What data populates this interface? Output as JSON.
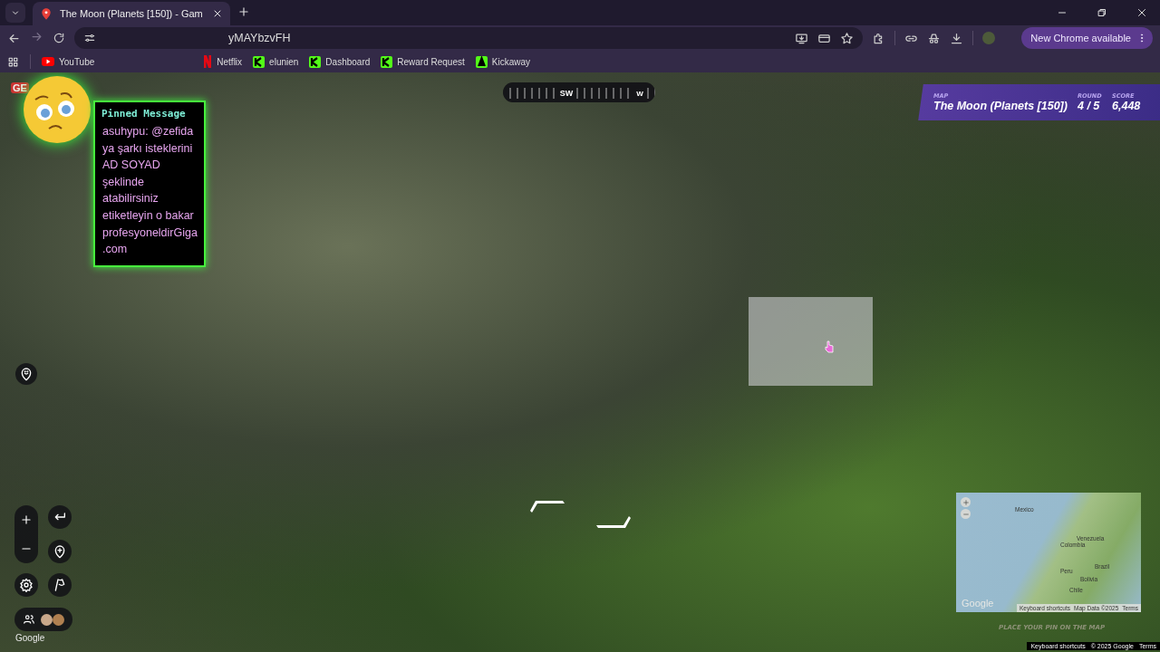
{
  "browser": {
    "tabs": [
      {
        "title": "The Moon (Planets [150]) - Gam",
        "selected": true
      }
    ],
    "address": "yMAYbzvFH",
    "update_button": "New Chrome available",
    "bookmarks": [
      {
        "label": "YouTube",
        "kind": "youtube"
      },
      {
        "label": "Netflix",
        "kind": "netflix"
      },
      {
        "label": "elunien",
        "kind": "kick"
      },
      {
        "label": "Dashboard",
        "kind": "kick"
      },
      {
        "label": "Reward Request",
        "kind": "kick"
      },
      {
        "label": "Kickaway",
        "kind": "kickaway"
      }
    ]
  },
  "pinned_message": {
    "title": "Pinned Message",
    "text": "asuhypu: @zefida ya şarkı isteklerini AD SOYAD şeklinde atabilirsiniz etiketleyin o bakar profesyoneldirGiga.com"
  },
  "game": {
    "logo": "GE",
    "compass": [
      "SW",
      "W"
    ],
    "hud": [
      {
        "label": "MAP",
        "value": "The Moon (Planets [150])"
      },
      {
        "label": "ROUND",
        "value": "4 / 5"
      },
      {
        "label": "SCORE",
        "value": "6,448"
      }
    ],
    "minimap": {
      "labels": [
        "Mexico",
        "Venezuela",
        "Colombia",
        "Peru",
        "Brazil",
        "Bolivia",
        "Chile"
      ],
      "logo": "Google",
      "attribution": [
        "Keyboard shortcuts",
        "Map Data ©2025",
        "Terms"
      ]
    },
    "prompt": "PLACE YOUR PIN ON THE MAP",
    "footer_logo": "Google",
    "footer": [
      "Keyboard shortcuts",
      "© 2025 Google",
      "Terms"
    ]
  }
}
